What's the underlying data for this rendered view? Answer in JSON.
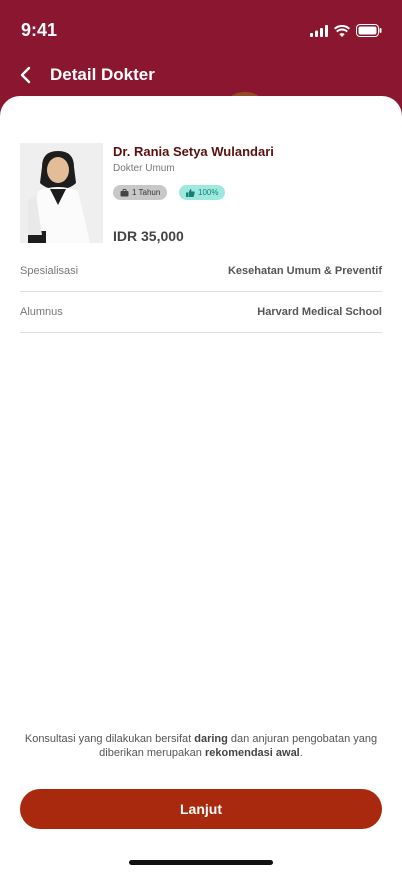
{
  "status_bar": {
    "time": "9:41"
  },
  "header": {
    "title": "Detail Dokter"
  },
  "doctor": {
    "name": "Dr. Rania Setya Wulandari",
    "specialty": "Dokter Umum",
    "experience": "1 Tahun",
    "rating": "100%",
    "price": "IDR 35,000"
  },
  "details": [
    {
      "label": "Spesialisasi",
      "value": "Kesehatan Umum & Preventif"
    },
    {
      "label": "Alumnus",
      "value": "Harvard Medical School"
    }
  ],
  "notice": {
    "part1": "Konsultasi yang dilakukan bersifat ",
    "bold1": "daring",
    "part2": " dan anjuran pengobatan yang diberikan merupakan ",
    "bold2": "rekomendasi awal",
    "part3": "."
  },
  "cta": {
    "label": "Lanjut"
  },
  "colors": {
    "header": "#8a1630",
    "button": "#a9290e"
  }
}
